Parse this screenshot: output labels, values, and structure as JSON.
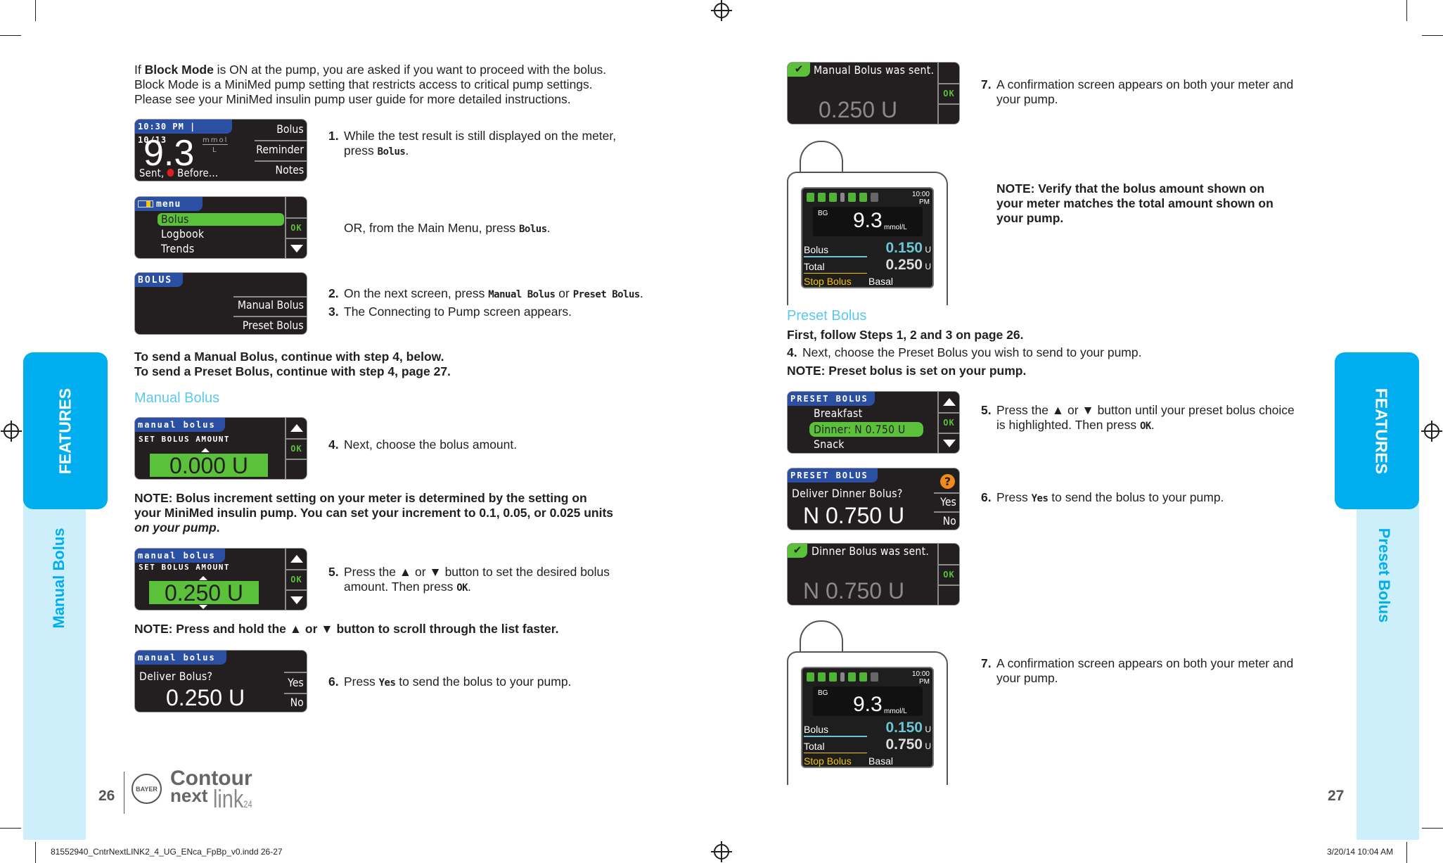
{
  "left_page": {
    "intro": {
      "line1_pre": "If ",
      "line1_bold": "Block Mode",
      "line1_post": " is ON at the pump, you are asked if you want to proceed with the bolus.",
      "line2": "Block Mode is a MiniMed pump setting that restricts access to critical pump settings.",
      "line3": "Please see your MiniMed insulin pump user guide for more detailed instructions."
    },
    "screen_result": {
      "header": "10:30 PM | 10/13",
      "value": "9.3",
      "unit_top": "mmol",
      "unit_bottom": "L",
      "status_pre": "Sent,",
      "status_post": "Before...",
      "menu": [
        "Bolus",
        "Reminder",
        "Notes"
      ]
    },
    "screen_menu": {
      "header": "menu",
      "items": [
        "Bolus",
        "Logbook",
        "Trends"
      ],
      "ok": "OK"
    },
    "screen_bolus": {
      "header": "BOLUS",
      "items": [
        "Manual Bolus",
        "Preset Bolus"
      ]
    },
    "step1": {
      "num": "1.",
      "line1": "While the test result is still displayed on the meter,",
      "line2_pre": "press ",
      "line2_key": "Bolus",
      "line2_post": "."
    },
    "or_text": {
      "pre": "OR, from the Main Menu, press ",
      "key": "Bolus",
      "post": "."
    },
    "step2": {
      "num": "2.",
      "pre": "On the next screen, press ",
      "key1": "Manual Bolus",
      "mid": " or ",
      "key2": "Preset Bolus",
      "post": "."
    },
    "step3": {
      "num": "3.",
      "text": "The Connecting to Pump screen appears."
    },
    "send_manual": "To send a Manual Bolus, continue with step 4, below.",
    "send_preset": "To send a Preset Bolus, continue with step 4, page 27.",
    "manual_heading": "Manual Bolus",
    "screen_set0": {
      "header": "manual bolus",
      "sub": "SET BOLUS AMOUNT",
      "value": "0.000 U",
      "ok": "OK"
    },
    "step4": {
      "num": "4.",
      "text": "Next, choose the bolus amount."
    },
    "note_increment": {
      "line1": "NOTE: Bolus increment setting on your meter is determined by the setting on",
      "line2": "your MiniMed insulin pump. You can set your increment to 0.1, 0.05, or 0.025 units",
      "line3_italic": "on your pump",
      "line3_post": "."
    },
    "screen_set250": {
      "header": "manual bolus",
      "sub": "SET BOLUS AMOUNT",
      "value": "0.250 U",
      "ok": "OK"
    },
    "step5": {
      "num": "5.",
      "line1": "Press the ▲ or ▼ button to set the desired bolus",
      "line2_pre": "amount. Then press ",
      "line2_key": "OK",
      "line2_post": "."
    },
    "note_hold": "NOTE: Press and hold the ▲ or ▼ button to scroll through the list faster.",
    "screen_deliver": {
      "header": "manual bolus",
      "question": "Deliver Bolus?",
      "value": "0.250 U",
      "yes": "Yes",
      "no": "No"
    },
    "step6": {
      "num": "6.",
      "pre": "Press ",
      "key": "Yes",
      "post": " to send the bolus to your pump."
    },
    "page_number": "26",
    "side_tab": "FEATURES",
    "side_label": "Manual Bolus",
    "logo": {
      "bayer": "BAYER",
      "brand1": "Contour",
      "brand2": "next",
      "brand3": "link",
      "brand_suffix": "24"
    },
    "slug": "81552940_CntrNextLINK2_4_UG_ENca_FpBp_v0.indd   26-27"
  },
  "right_page": {
    "screen_sent": {
      "message": "Manual Bolus was sent.",
      "value": "0.250 U",
      "ok": "OK"
    },
    "step7a": {
      "num": "7.",
      "line1": "A confirmation screen appears on both your meter and",
      "line2": "your pump."
    },
    "pump1": {
      "time1": "10:00",
      "time2": "PM",
      "bg_label": "BG",
      "bg_value": "9.3",
      "bg_unit": "mmol/L",
      "bolus_label": "Bolus",
      "bolus_value": "0.150",
      "total_label": "Total",
      "total_value": "0.250",
      "unit": "U",
      "stop": "Stop Bolus",
      "basal": "Basal"
    },
    "note_verify": {
      "line1": "NOTE: Verify that the bolus amount shown on",
      "line2": "your meter matches the total amount shown on",
      "line3": "your pump."
    },
    "preset_heading": "Preset Bolus",
    "first_follow": "First, follow Steps 1, 2 and 3 on page 26.",
    "step4": {
      "num": "4.",
      "text": "Next, choose the Preset Bolus you wish to send to your pump."
    },
    "note_preset": "NOTE: Preset bolus is set on your pump.",
    "screen_preset_list": {
      "header": "PRESET BOLUS",
      "items": [
        "Breakfast",
        "Dinner: N 0.750 U",
        "Snack"
      ],
      "ok": "OK"
    },
    "step5": {
      "num": "5.",
      "line1": "Press the ▲ or ▼ button until your preset bolus choice",
      "line2_pre": "is highlighted. Then press ",
      "line2_key": "OK",
      "line2_post": "."
    },
    "screen_preset_deliver": {
      "header": "PRESET BOLUS",
      "question": "Deliver Dinner Bolus?",
      "value": "N 0.750 U",
      "yes": "Yes",
      "no": "No",
      "help": "?"
    },
    "step6": {
      "num": "6.",
      "pre": "Press ",
      "key": "Yes",
      "post": " to send the bolus to your pump."
    },
    "screen_preset_sent": {
      "message": "Dinner Bolus was sent.",
      "value": "N 0.750 U",
      "ok": "OK"
    },
    "pump2": {
      "time1": "10:00",
      "time2": "PM",
      "bg_label": "BG",
      "bg_value": "9.3",
      "bg_unit": "mmol/L",
      "bolus_label": "Bolus",
      "bolus_value": "0.150",
      "total_label": "Total",
      "total_value": "0.750",
      "unit": "U",
      "stop": "Stop Bolus",
      "basal": "Basal"
    },
    "step7b": {
      "num": "7.",
      "line1": "A confirmation screen appears on both your meter and",
      "line2": "your pump."
    },
    "page_number": "27",
    "side_tab": "FEATURES",
    "side_label": "Preset Bolus",
    "slug_date": "3/20/14   10:04 AM"
  },
  "colors": {
    "accent_blue": "#00aeef",
    "light_blue": "#cdeefb",
    "heading_blue": "#5bc8f0",
    "screen_bg": "#231f20",
    "screen_header": "#2b4fa2",
    "highlight_green": "#5bc13a",
    "pump_bolus_cyan": "#6cc5d6",
    "stop_yellow": "#f5c400"
  }
}
